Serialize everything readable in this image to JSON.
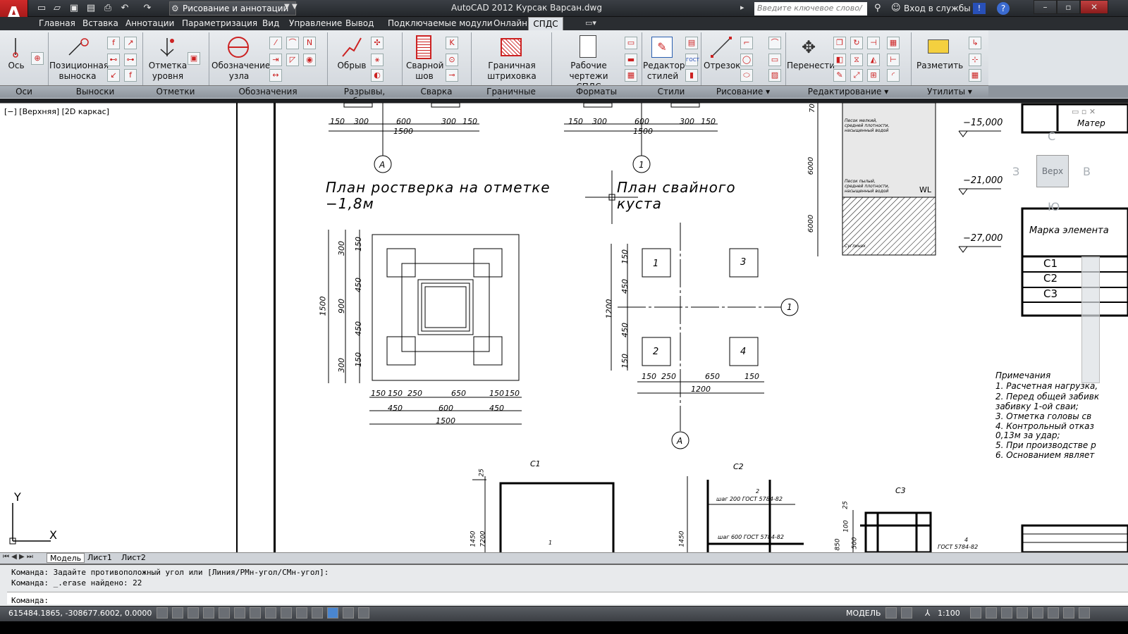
{
  "titlebar": {
    "workspace": "Рисование и аннотации",
    "title": "AutoCAD 2012  Курсак Варсан.dwg",
    "search_placeholder": "Введите ключевое слово/фразу",
    "login": "Вход в службы"
  },
  "menu": [
    "Главная",
    "Вставка",
    "Аннотации",
    "Параметризация",
    "Вид",
    "Управление",
    "Вывод",
    "Подключаемые модули",
    "Онлайн",
    "СПДС"
  ],
  "ribbon": {
    "buttons": {
      "os": "Ось",
      "pos1": "Позиционная",
      "pos2": "выноска",
      "otm1": "Отметка",
      "otm2": "уровня",
      "obz1": "Обозначение",
      "obz2": "узла",
      "obryv": "Обрыв",
      "svar1": "Сварной",
      "svar2": "шов",
      "gran1": "Граничная",
      "gran2": "штриховка",
      "rab1": "Рабочие",
      "rab2": "чертежи СПДС",
      "red1": "Редактор",
      "red2": "стилей",
      "otrezok": "Отрезок",
      "perenesti": "Перенести",
      "razmetit": "Разметить"
    },
    "groups": [
      "Оси",
      "Выноски",
      "Отметки уровня",
      "Обозначения",
      "Разрывы, обрывы",
      "Сварка",
      "Граничные формы",
      "Форматы",
      "Стили",
      "Рисование ▾",
      "Редактирование ▾",
      "Утилиты ▾"
    ]
  },
  "viewport": {
    "label": "[−] [Верхняя] [2D каркас]",
    "navcube": {
      "top": "Верх",
      "n": "С",
      "s": "Ю",
      "w": "З",
      "e": "В"
    }
  },
  "drawing": {
    "plan1_line1": "План ростверка на отметке",
    "plan1_line2": "−1,8м",
    "plan2_line1": "План свайного",
    "plan2_line2": "куста",
    "axis_a": "А",
    "axis_1": "1",
    "dims_top": [
      "150",
      "300",
      "600",
      "300",
      "150"
    ],
    "dim_total": "1500",
    "dim_1200": "1200",
    "dims_bottom1": [
      "150",
      "150",
      "250",
      "650",
      "150",
      "150"
    ],
    "dims_bottom2": [
      "450",
      "600",
      "450"
    ],
    "dims_left": [
      "300",
      "150",
      "450",
      "900",
      "450",
      "150",
      "300"
    ],
    "dims_left_total": "1500",
    "pile_dims_left": [
      "150",
      "450",
      "450",
      "150"
    ],
    "pile_dims_bottom": [
      "150",
      "250",
      "650",
      "150"
    ],
    "piles": [
      "1",
      "2",
      "3",
      "4"
    ],
    "levels": [
      "−15,000",
      "−21,000",
      "−27,000"
    ],
    "soil_dims": [
      "70",
      "6000",
      "6000"
    ],
    "soil_labels": [
      "Песок мелкий, средней плотности, насыщенный водой",
      "Песок пылый, средней плотности, насыщенный водой",
      "WL",
      "Суглинок"
    ],
    "table_headers": [
      "Матер",
      "Марка элемента"
    ],
    "table_rows": [
      "С1",
      "С2",
      "С3"
    ],
    "notes_title": "Примечания",
    "notes": [
      "1.  Расчетная нагрузка,",
      "2.  Перед общей забивк",
      "забивку 1-ой сваи;",
      "3.  Отметка головы св",
      "4.  Контрольный отказ",
      "0,13м за удар;",
      "5.  При производстве р",
      "6.  Основанием являет"
    ],
    "detail_labels": [
      "С1",
      "С2",
      "С3"
    ],
    "detail_notes": [
      "шаг 200 ГОСТ 5784-82",
      "шаг 600 ГОСТ 5784-82",
      "ГОСТ 5784-82"
    ],
    "detail_dims": [
      "25",
      "1450",
      "7200",
      "1450",
      "25",
      "100",
      "500",
      "850"
    ],
    "detail_positions": [
      "1",
      "2",
      "4"
    ]
  },
  "layout_tabs": [
    "Модель",
    "Лист1",
    "Лист2"
  ],
  "command": {
    "line1": "Команда: Задайте противоположный угол или [Линия/РМн-угол/СМн-угол]:",
    "line2": "Команда: _.erase найдено: 22",
    "prompt": "Команда:"
  },
  "status": {
    "coords": "615484.1865, -308677.6002, 0.0000",
    "model": "МОДЕЛЬ",
    "scale": "1:100"
  },
  "colors": {
    "accent": "#c22222",
    "ribbon": "#dfe3e8",
    "titlebar": "#2a2d31"
  }
}
